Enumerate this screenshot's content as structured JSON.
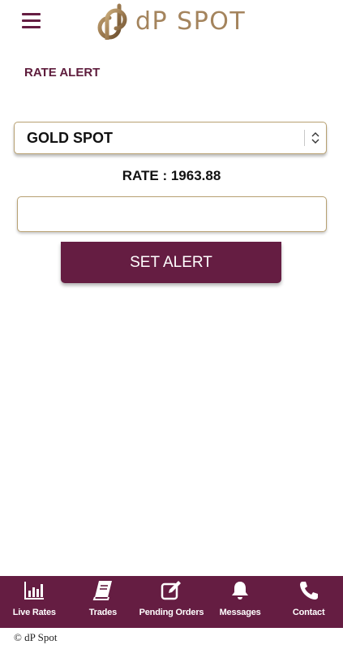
{
  "header": {
    "brand": "dP SPOT",
    "menu_icon": "hamburger-menu-icon",
    "logo_icon": "dp-logo-icon"
  },
  "page": {
    "title": "RATE ALERT"
  },
  "alert_form": {
    "instrument_select": {
      "selected": "GOLD SPOT",
      "icon": "up-down-chevron-icon"
    },
    "rate_text": "RATE : 1963.88",
    "alert_input": {
      "value": "",
      "placeholder": ""
    },
    "submit_label": "SET ALERT"
  },
  "bottom_nav": {
    "items": [
      {
        "label": "Live Rates",
        "icon": "bar-chart-icon"
      },
      {
        "label": "Trades",
        "icon": "book-icon"
      },
      {
        "label": "Pending Orders",
        "icon": "edit-icon"
      },
      {
        "label": "Messages",
        "icon": "bell-icon"
      },
      {
        "label": "Contact",
        "icon": "phone-icon"
      }
    ]
  },
  "footer": {
    "copyright": "© dP Spot"
  },
  "colors": {
    "brand": "#651d42",
    "gold": "#a4845d",
    "border": "#b8a172",
    "background": "#ffffff"
  }
}
